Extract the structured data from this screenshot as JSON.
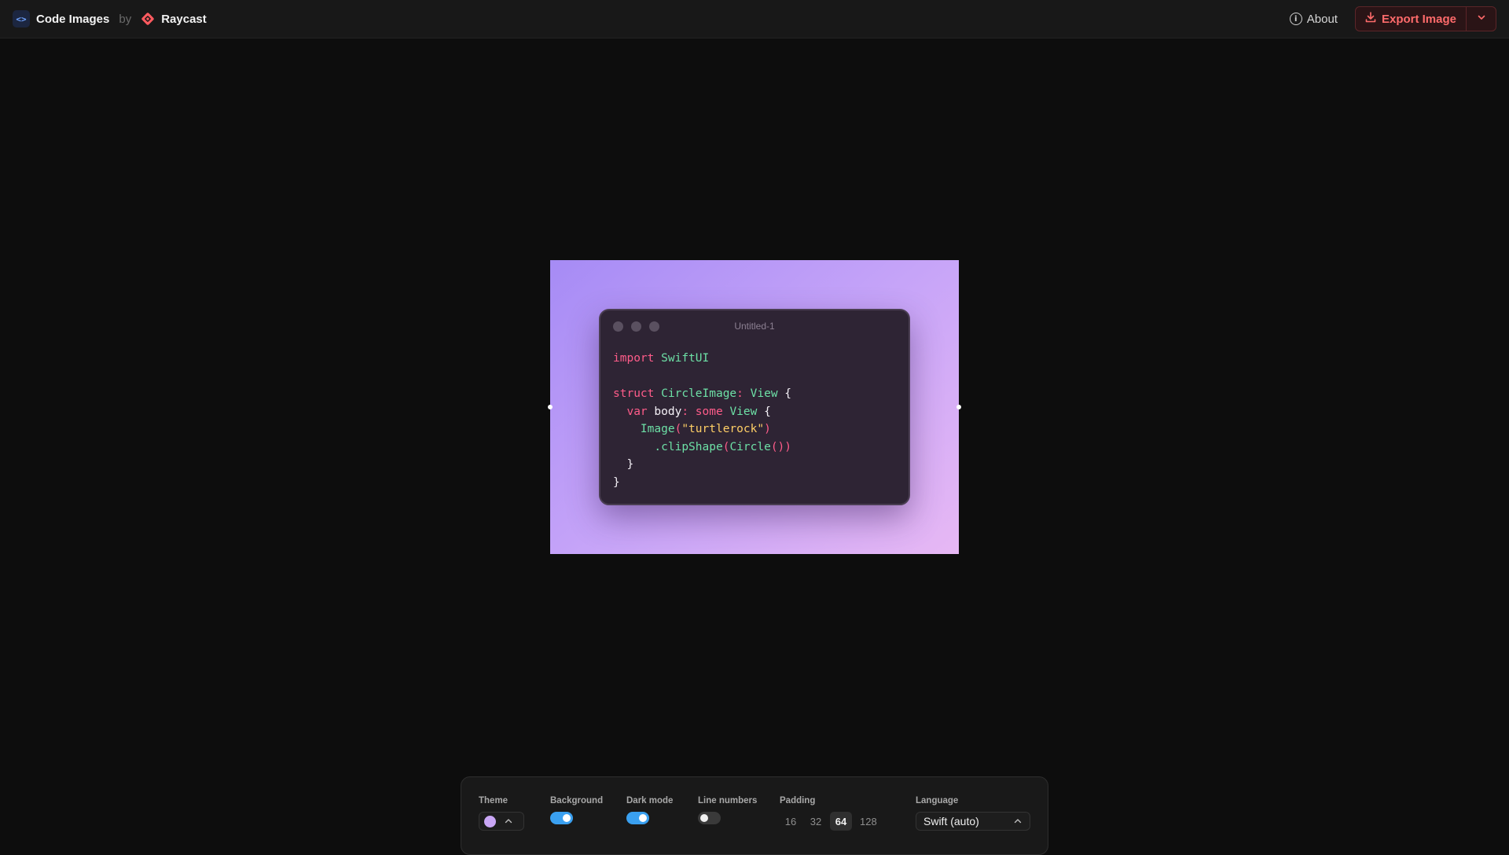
{
  "header": {
    "app_name": "Code Images",
    "by": "by",
    "partner_name": "Raycast",
    "about_label": "About",
    "export_label": "Export Image",
    "app_icon": "code-brackets-icon",
    "partner_icon": "raycast-logo-icon"
  },
  "editor": {
    "window_title": "Untitled-1",
    "code_lines": [
      "import SwiftUI",
      "",
      "struct CircleImage: View {",
      "  var body: some View {",
      "    Image(\"turtlerock\")",
      "      .clipShape(Circle())",
      "  }",
      "}"
    ],
    "background_gradient": [
      "#a68bf5",
      "#c6a4f8",
      "#e7b8f4"
    ],
    "window_bg": "#2e2434"
  },
  "controls": {
    "theme": {
      "label": "Theme",
      "swatch_color": "#c9a6f5"
    },
    "background": {
      "label": "Background",
      "enabled": true
    },
    "dark_mode": {
      "label": "Dark mode",
      "enabled": true
    },
    "line_numbers": {
      "label": "Line numbers",
      "enabled": false
    },
    "padding": {
      "label": "Padding",
      "options": [
        "16",
        "32",
        "64",
        "128"
      ],
      "selected": "64"
    },
    "language": {
      "label": "Language",
      "value": "Swift (auto)"
    }
  },
  "colors": {
    "accent_export": "#ff6b6b",
    "toggle_on": "#3aa0f0",
    "keyword": "#ff5c8a",
    "type": "#6de0a6",
    "string": "#ffcf66"
  }
}
